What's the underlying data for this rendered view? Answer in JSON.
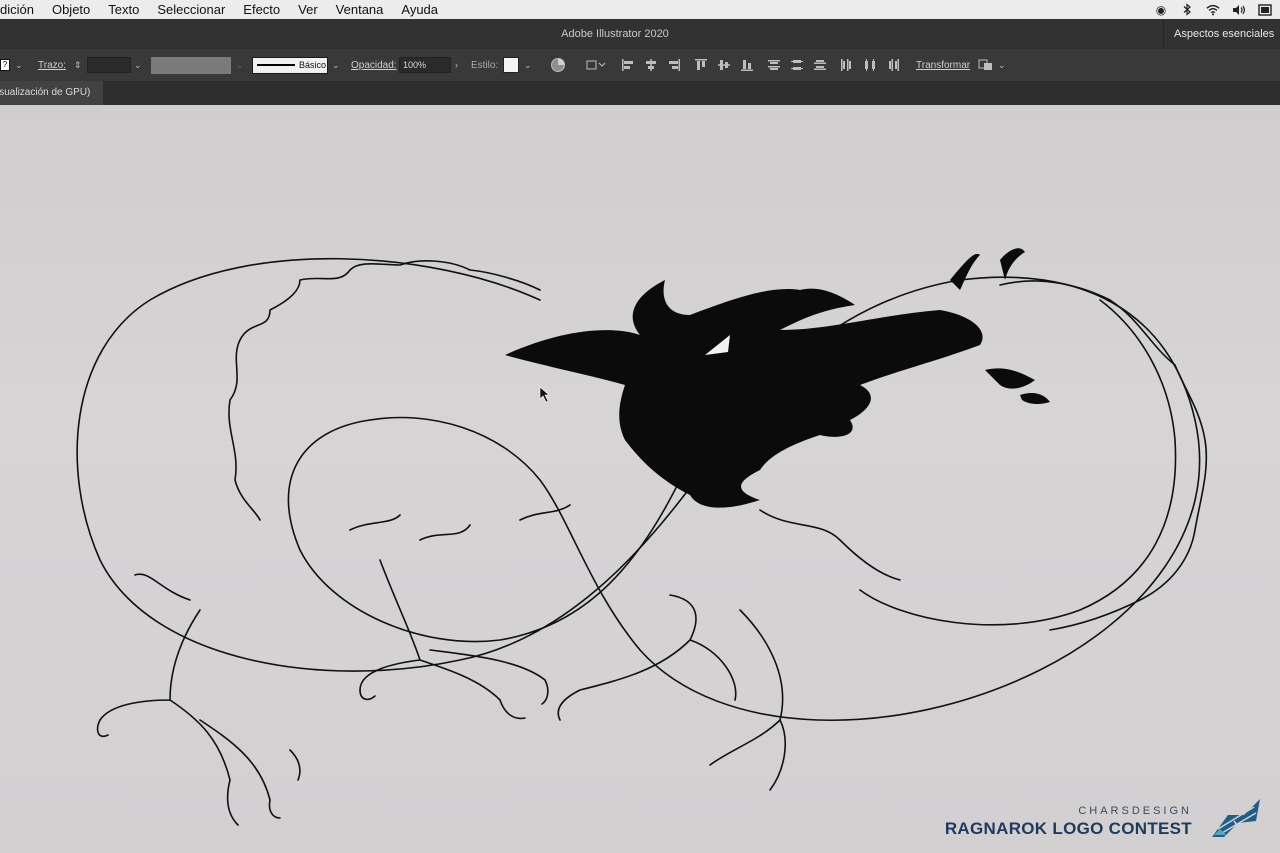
{
  "menubar": {
    "items": [
      "dición",
      "Objeto",
      "Texto",
      "Seleccionar",
      "Efecto",
      "Ver",
      "Ventana",
      "Ayuda"
    ]
  },
  "window": {
    "title": "Adobe Illustrator 2020",
    "workspace": "Aspectos esenciales"
  },
  "controlbar": {
    "stroke_label": "Trazo:",
    "brush_label": "Básico",
    "opacity_label": "Opacidad:",
    "opacity_value": "100%",
    "style_label": "Estilo:",
    "transform_label": "Transformar"
  },
  "document": {
    "tab_label": "isualización de GPU)"
  },
  "branding": {
    "subtitle": "CHARSDESIGN",
    "title": "RAGNAROK LOGO CONTEST",
    "logo_color": "#1f5f86"
  }
}
